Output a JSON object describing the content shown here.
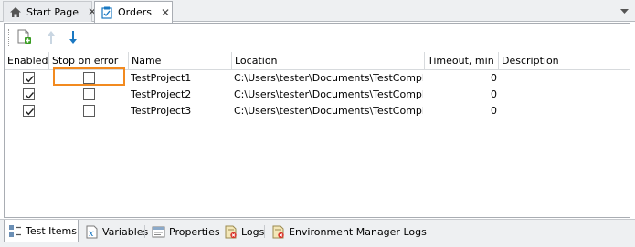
{
  "document_tabs": [
    {
      "label": "Start Page",
      "icon": "home-icon",
      "active": false
    },
    {
      "label": "Orders",
      "icon": "orders-icon",
      "active": true
    }
  ],
  "toolbar": {
    "buttons": [
      {
        "icon": "add-test-item-icon",
        "enabled": true
      },
      {
        "icon": "move-up-icon",
        "enabled": false
      },
      {
        "icon": "move-down-icon",
        "enabled": true
      }
    ]
  },
  "grid": {
    "columns": [
      "Enabled",
      "Stop on error",
      "Name",
      "Location",
      "Timeout, min",
      "Description"
    ],
    "rows": [
      {
        "enabled": true,
        "stop_on_error": false,
        "name": "TestProject1",
        "location": "C:\\Users\\tester\\Documents\\TestComple…",
        "timeout": "0",
        "description": ""
      },
      {
        "enabled": true,
        "stop_on_error": false,
        "name": "TestProject2",
        "location": "C:\\Users\\tester\\Documents\\TestComple…",
        "timeout": "0",
        "description": ""
      },
      {
        "enabled": true,
        "stop_on_error": false,
        "name": "TestProject3",
        "location": "C:\\Users\\tester\\Documents\\TestComple…",
        "timeout": "0",
        "description": ""
      }
    ]
  },
  "bottom_tabs": [
    {
      "label": "Test Items",
      "icon": "test-items-icon",
      "active": true
    },
    {
      "label": "Variables",
      "icon": "variables-icon",
      "active": false
    },
    {
      "label": "Properties",
      "icon": "properties-icon",
      "active": false
    },
    {
      "label": "Logs",
      "icon": "logs-icon",
      "active": false
    },
    {
      "label": "Environment Manager Logs",
      "icon": "environment-logs-icon",
      "active": false
    }
  ],
  "colors": {
    "highlight": "#f28a1f",
    "accent_blue": "#1a78c2",
    "add_green": "#3a9d23"
  }
}
